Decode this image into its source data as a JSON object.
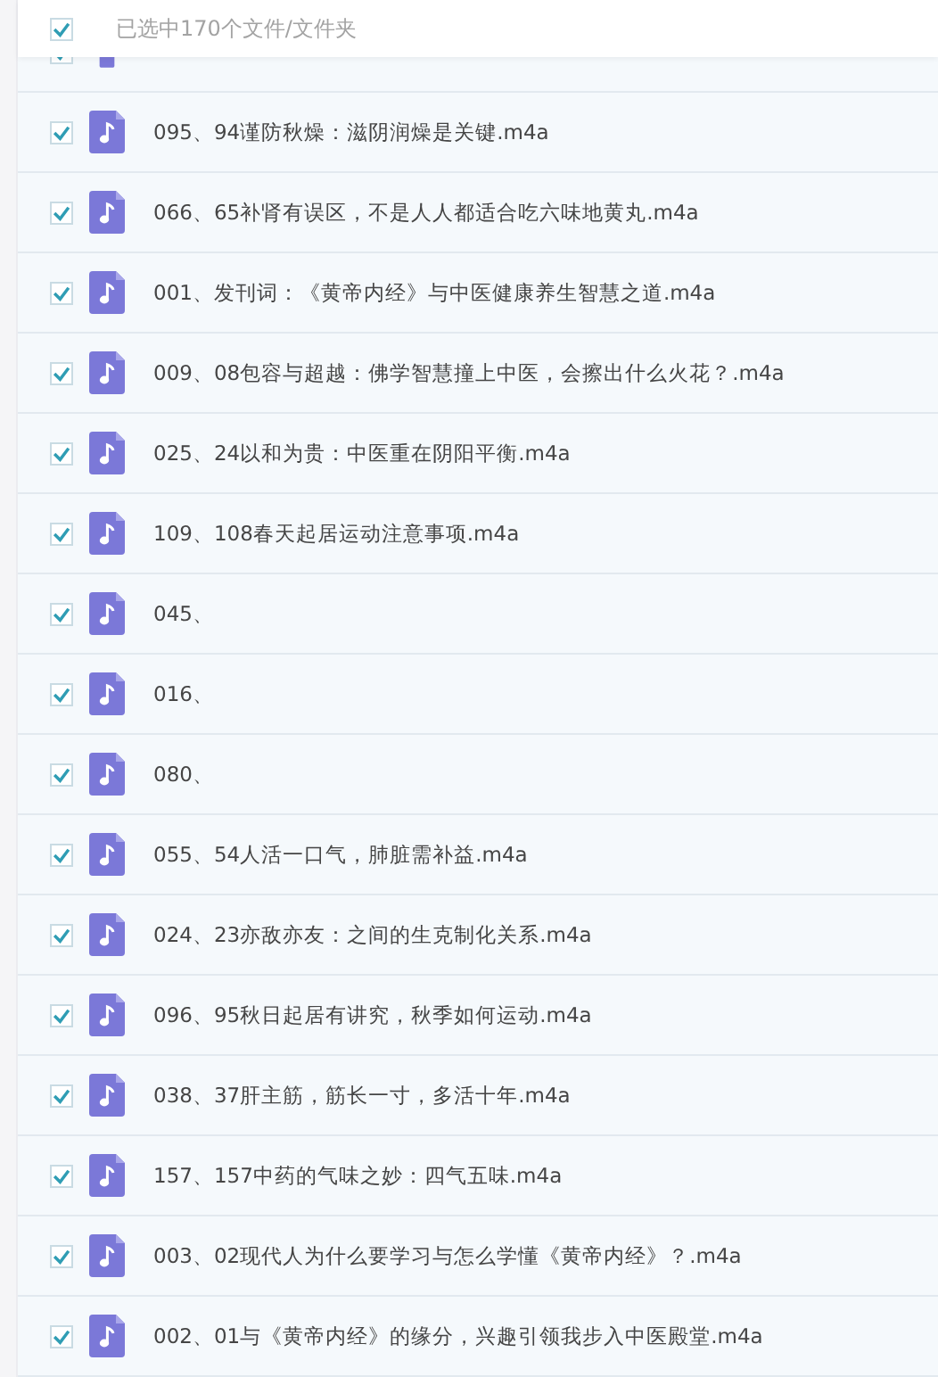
{
  "header": {
    "checked": true,
    "label": "已选中170个文件/文件夹"
  },
  "files": [
    {
      "kind": "clipped",
      "checked": true
    },
    {
      "kind": "file",
      "checked": true,
      "name": "095、94谨防秋燥：滋阴润燥是关键.m4a"
    },
    {
      "kind": "file",
      "checked": true,
      "name": "066、65补肾有误区，不是人人都适合吃六味地黄丸.m4a"
    },
    {
      "kind": "file",
      "checked": true,
      "name": "001、发刊词：《黄帝内经》与中医健康养生智慧之道.m4a"
    },
    {
      "kind": "file",
      "checked": true,
      "name": "009、08包容与超越：佛学智慧撞上中医，会擦出什么火花？.m4a"
    },
    {
      "kind": "file",
      "checked": true,
      "name": "025、24以和为贵：中医重在阴阳平衡.m4a"
    },
    {
      "kind": "file",
      "checked": true,
      "name": "109、108春天起居运动注意事项.m4a"
    },
    {
      "kind": "file",
      "checked": true,
      "name": "045、"
    },
    {
      "kind": "file",
      "checked": true,
      "name": "016、"
    },
    {
      "kind": "file",
      "checked": true,
      "name": "080、"
    },
    {
      "kind": "file",
      "checked": true,
      "name": "055、54人活一口气，肺脏需补益.m4a"
    },
    {
      "kind": "file",
      "checked": true,
      "name": "024、23亦敌亦友：之间的生克制化关系.m4a"
    },
    {
      "kind": "file",
      "checked": true,
      "name": "096、95秋日起居有讲究，秋季如何运动.m4a"
    },
    {
      "kind": "file",
      "checked": true,
      "name": "038、37肝主筋，筋长一寸，多活十年.m4a"
    },
    {
      "kind": "file",
      "checked": true,
      "name": "157、157中药的气味之妙：四气五味.m4a"
    },
    {
      "kind": "file",
      "checked": true,
      "name": "003、02现代人为什么要学习与怎么学懂《黄帝内经》？.m4a"
    },
    {
      "kind": "file",
      "checked": true,
      "name": "002、01与《黄帝内经》的缘分，兴趣引领我步入中医殿堂.m4a"
    }
  ]
}
